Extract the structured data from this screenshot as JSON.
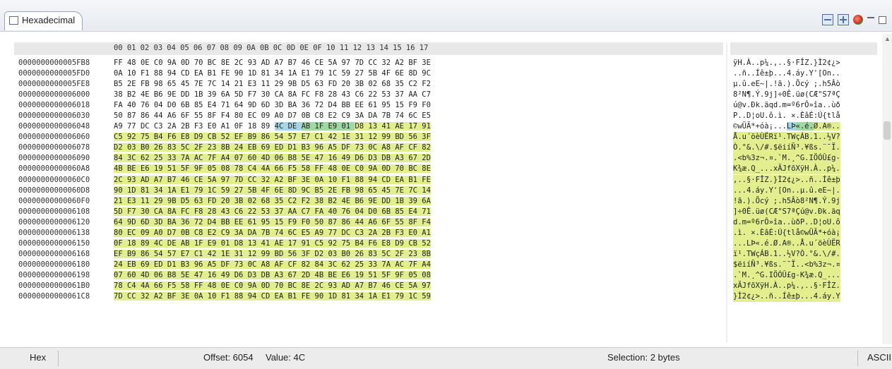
{
  "window": {
    "tab_title": "Hexadecimal",
    "toolbar_icons": [
      "collapse-icon",
      "expand-icon",
      "target-icon",
      "minimize-icon",
      "maximize-icon"
    ]
  },
  "hex_header": "00 01 02 03 04 05 06 07 08 09 0A 0B 0C 0D 0E 0F 10 11 12 13 14 15 16 17",
  "rows": [
    {
      "addr": "0000000000005FB8",
      "hex": "FF 48 0E C0 9A 0D 70 BC 8E 2C 93 AD A7 B7 46 CE 5A 97 7D CC 32 A2 BF 3E",
      "ascii": "ÿH.À..p¼.,..§·FÎZ.}Ì2¢¿>"
    },
    {
      "addr": "0000000000005FD0",
      "hex": "0A 10 F1 88 94 CD EA B1 FE 90 1D 81 34 1A E1 79 1C 59 27 5B 4F 6E 8D 9C",
      "ascii": "..ñ..Íê±þ...4.áy.Y'[On.."
    },
    {
      "addr": "0000000000005FE8",
      "hex": "B5 2E FB 98 65 45 7E 7C 14 21 E3 11 29 9B D5 63 FD 20 3B 02 68 35 C2 F2",
      "ascii": "µ.û.eE~|.!ã.).Õcý ;.h5Âò"
    },
    {
      "addr": "0000000000006000",
      "hex": "38 B2 4E B6 9E DD 1B 39 6A 5D F7 30 CA 8A FC F8 28 43 C6 22 53 37 AA C7",
      "ascii": "8²N¶.Ý.9j]÷0Ê.üø(CÆ\"S7ªÇ"
    },
    {
      "addr": "0000000000006018",
      "hex": "FA 40 76 04 D0 6B 85 E4 71 64 9D 6D 3D BA 36 72 D4 BB EE 61 95 15 F9 F0",
      "ascii": "ú@v.Ðk.äqd.m=º6rÔ»îa..ùð"
    },
    {
      "addr": "0000000000006030",
      "hex": "50 87 86 44 A6 6F 55 8F F4 80 EC 09 A0 D7 0B C8 E2 C9 3A DA 7B 74 6C E5",
      "ascii": "P..D¦oU.ô.ì. ×.ÈâÉ:Ú{tlå"
    },
    {
      "addr": "0000000000006048",
      "hex": "A9 77 DC C3 2A 2B F3 E0 A1 0F 18 89 4C DE AB 1F E9 01 D8 13 41 AE 17 91",
      "ascii": "©wÜÃ*+óà¡...LÞ«.é.Ø.A®.."
    },
    {
      "addr": "0000000000006060",
      "hex": "C5 92 75 B4 F6 E8 D9 CB 52 EF B9 86 54 57 E7 C1 42 1E 31 12 99 BD 56 3F",
      "ascii": "Å.u´öèÙËRï¹.TWçÁB.1..½V?"
    },
    {
      "addr": "0000000000006078",
      "hex": "D2 03 B0 26 83 5C 2F 23 8B 24 EB 69 ED D1 B3 96 A5 DF 73 0C A8 AF CF 82",
      "ascii": "Ò.°&.\\/#.$ëiíÑ³.¥ßs.¨¯Ï."
    },
    {
      "addr": "0000000000006090",
      "hex": "84 3C 62 25 33 7A AC 7F A4 07 60 4D 06 B8 5E 47 16 49 D6 D3 DB A3 67 2D",
      "ascii": ".<b%3z¬.¤.`M.¸^G.IÖÓÛ£g-"
    },
    {
      "addr": "00000000000060A8",
      "hex": "4B BE E6 19 51 5F 9F 05 08 78 C4 4A 66 F5 58 FF 48 0E C0 9A 0D 70 BC 8E",
      "ascii": "K¾æ.Q_...xÄJfõXÿH.À..p¼."
    },
    {
      "addr": "00000000000060C0",
      "hex": "2C 93 AD A7 B7 46 CE 5A 97 7D CC 32 A2 BF 3E 0A 10 F1 88 94 CD EA B1 FE",
      "ascii": ",..§·FÎZ.}Ì2¢¿>..ñ..Íê±þ"
    },
    {
      "addr": "00000000000060D8",
      "hex": "90 1D 81 34 1A E1 79 1C 59 27 5B 4F 6E 8D 9C B5 2E FB 98 65 45 7E 7C 14",
      "ascii": "...4.áy.Y'[On..µ.û.eE~|."
    },
    {
      "addr": "00000000000060F0",
      "hex": "21 E3 11 29 9B D5 63 FD 20 3B 02 68 35 C2 F2 38 B2 4E B6 9E DD 1B 39 6A",
      "ascii": "!ã.).Õcý ;.h5Âò8²N¶.Ý.9j"
    },
    {
      "addr": "0000000000006108",
      "hex": "5D F7 30 CA 8A FC F8 28 43 C6 22 53 37 AA C7 FA 40 76 04 D0 6B 85 E4 71",
      "ascii": "]÷0Ê.üø(CÆ\"S7ªÇú@v.Ðk.äq"
    },
    {
      "addr": "0000000000006120",
      "hex": "64 9D 6D 3D BA 36 72 D4 BB EE 61 95 15 F9 F0 50 87 86 44 A6 6F 55 8F F4",
      "ascii": "d.m=º6rÔ»îa..ùðP..D¦oU.ô"
    },
    {
      "addr": "0000000000006138",
      "hex": "80 EC 09 A0 D7 0B C8 E2 C9 3A DA 7B 74 6C E5 A9 77 DC C3 2A 2B F3 E0 A1",
      "ascii": ".ì. ×.ÈâÉ:Ú{tlå©wÜÃ*+óà¡"
    },
    {
      "addr": "0000000000006150",
      "hex": "0F 18 89 4C DE AB 1F E9 01 D8 13 41 AE 17 91 C5 92 75 B4 F6 E8 D9 CB 52",
      "ascii": "...LÞ«.é.Ø.A®..Å.u´öèÙËR"
    },
    {
      "addr": "0000000000006168",
      "hex": "EF B9 86 54 57 E7 C1 42 1E 31 12 99 BD 56 3F D2 03 B0 26 83 5C 2F 23 8B",
      "ascii": "ï¹.TWçÁB.1..½V?Ò.°&.\\/#."
    },
    {
      "addr": "0000000000006180",
      "hex": "24 EB 69 ED D1 B3 96 A5 DF 73 0C A8 AF CF 82 84 3C 62 25 33 7A AC 7F A4",
      "ascii": "$ëiíÑ³.¥ßs.¨¯Ï..<b%3z¬.¤"
    },
    {
      "addr": "0000000000006198",
      "hex": "07 60 4D 06 B8 5E 47 16 49 D6 D3 DB A3 67 2D 4B BE E6 19 51 5F 9F 05 08",
      "ascii": ".`M.¸^G.IÖÓÛ£g-K¾æ.Q_..."
    },
    {
      "addr": "00000000000061B0",
      "hex": "78 C4 4A 66 F5 58 FF 48 0E C0 9A 0D 70 BC 8E 2C 93 AD A7 B7 46 CE 5A 97",
      "ascii": "xÄJfõXÿH.À..p¼.,..§·FÎZ."
    },
    {
      "addr": "00000000000061C8",
      "hex": "7D CC 32 A2 BF 3E 0A 10 F1 88 94 CD EA B1 FE 90 1D 81 34 1A E1 79 1C 59",
      "ascii": "}Ì2¢¿>..ñ..Íê±þ...4.áy.Y"
    }
  ],
  "status": {
    "mode": "Hex",
    "offset": "Offset: 6054",
    "value": "Value: 4C",
    "selection": "Selection: 2 bytes",
    "encoding": "ASCII"
  },
  "colors": {
    "highlight": "#e3ef8e",
    "selection_blue": "#a5d7e6",
    "selection_green": "#9fd8a0"
  }
}
